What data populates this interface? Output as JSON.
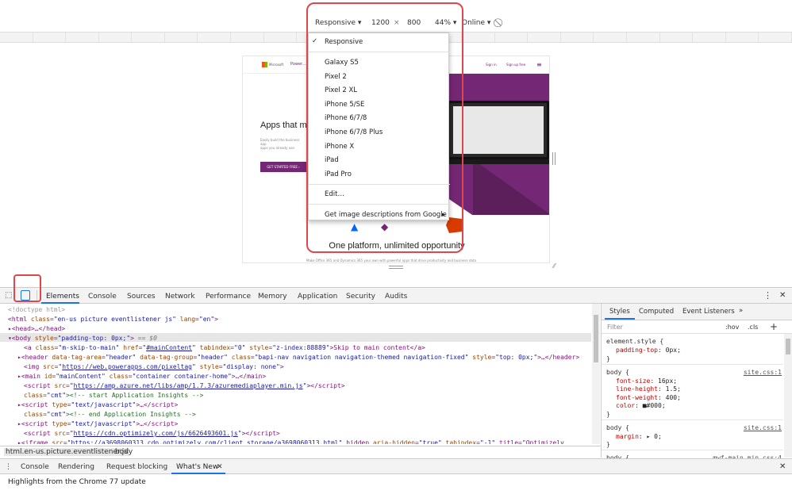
{
  "toolbar": {
    "device": "Responsive",
    "width": "1200",
    "times": "×",
    "height": "800",
    "zoom": "44%",
    "network": "Online"
  },
  "dropdown": {
    "items": [
      "Responsive",
      "Galaxy S5",
      "Pixel 2",
      "Pixel 2 XL",
      "iPhone 5/SE",
      "iPhone 6/7/8",
      "iPhone 6/7/8 Plus",
      "iPhone X",
      "iPad",
      "iPad Pro",
      "Edit…",
      "Get image descriptions from Google"
    ],
    "check": "✓",
    "submenu": "▸"
  },
  "site": {
    "brand": "Microsoft",
    "product": "Power...",
    "signin": "Sign in",
    "signup": "Sign up free",
    "hero_title": "Apps that m",
    "hero_sub": "Easily build the business app\napps you already use.",
    "cta": "GET STARTED FREE ›",
    "section_title": "One platform, unlimited opportunity",
    "section_sub": "Make Office 365 and Dynamics 365 your own with powerful apps that drive productivity and business data"
  },
  "devtools": {
    "tabs": [
      "Elements",
      "Console",
      "Sources",
      "Network",
      "Performance",
      "Memory",
      "Application",
      "Security",
      "Audits"
    ],
    "active_tab": "Elements",
    "more": "⋮",
    "close": "✕"
  },
  "code": [
    {
      "html": "&lt;!doctype html&gt;"
    },
    {
      "html": "&lt;html class=\"en-us picture eventlistener js\" lang=\"en\"&gt;"
    },
    {
      "html": "▸&lt;head&gt;…&lt;/head&gt;"
    },
    {
      "html": "▾&lt;body style=\"padding-top: 0px;\"&gt; == $0"
    },
    {
      "html": "&lt;a class=\"m-skip-to-main\" href=\"#mainContent\" tabindex=\"0\" style=\"z-index:88889\"&gt;Skip to main content&lt;/a&gt;"
    },
    {
      "html": "▸&lt;header data-tag-area=\"header\" data-tag-group=\"header\" class=\"bapi-nav navigation navigation-themed navigation-fixed\" style=\"top: 0px;\"&gt;…&lt;/header&gt;"
    },
    {
      "html": "&lt;img src=\"https://web.powerapps.com/pixeltag\" style=\"display: none\"&gt;"
    },
    {
      "html": "▸&lt;main id=\"mainContent\" class=\"container container-home\"&gt;…&lt;/main&gt;"
    },
    {
      "html": "&lt;script src=\"https://amp.azure.net/libs/amp/1.7.3/azuremediaplayer.min.js\"&gt;&lt;/script&gt;"
    },
    {
      "html": "&lt;!-- start Application Insights --&gt;"
    },
    {
      "html": "▸&lt;script type=\"text/javascript\"&gt;…&lt;/script&gt;"
    },
    {
      "html": "&lt;!-- end Application Insights --&gt;"
    },
    {
      "html": "▸&lt;script type=\"text/javascript\"&gt;…&lt;/script&gt;"
    },
    {
      "html": "&lt;script src=\"https://cdn.optimizely.com/js/6626493601.js\"&gt;&lt;/script&gt;"
    },
    {
      "html": "▸&lt;iframe src=\"https://a3698060313.cdn.optimizely.com/client_storage/a3698060313.html\" hidden aria-hidden=\"true\" tabindex=\"-1\" title=\"Optimizely"
    }
  ],
  "breadcrumb": [
    "html.en-us.picture.eventlistener.js",
    "body"
  ],
  "styles": {
    "tabs": [
      "Styles",
      "Computed",
      "Event Listeners"
    ],
    "more": "»",
    "filter": "Filter",
    "hov": ":hov",
    ".cls": ".cls",
    "plus": "+",
    "rules": [
      {
        "selector": "element.style {",
        "source": "",
        "props": [
          [
            "padding-top",
            "0px;"
          ]
        ]
      },
      {
        "selector": "body {",
        "source": "site.css:1",
        "props": [
          [
            "font-size",
            "16px;"
          ],
          [
            "line-height",
            "1.5;"
          ],
          [
            "font-weight",
            "400;"
          ],
          [
            "color",
            "■#000;"
          ]
        ]
      },
      {
        "selector": "body {",
        "source": "site.css:1",
        "props": [
          [
            "margin",
            "▸ 0;"
          ]
        ]
      },
      {
        "selector": "body {",
        "source": "mwf-main.min.css:4",
        "props": []
      }
    ]
  },
  "drawer": {
    "tabs": [
      "Console",
      "Rendering",
      "Request blocking",
      "What's New"
    ],
    "active": "What's New",
    "close": "✕",
    "body": "Highlights from the Chrome 77 update"
  },
  "colors": {
    "accent": "#742774",
    "highlight": "#e0474c",
    "tab_active": "#1a73e8"
  }
}
